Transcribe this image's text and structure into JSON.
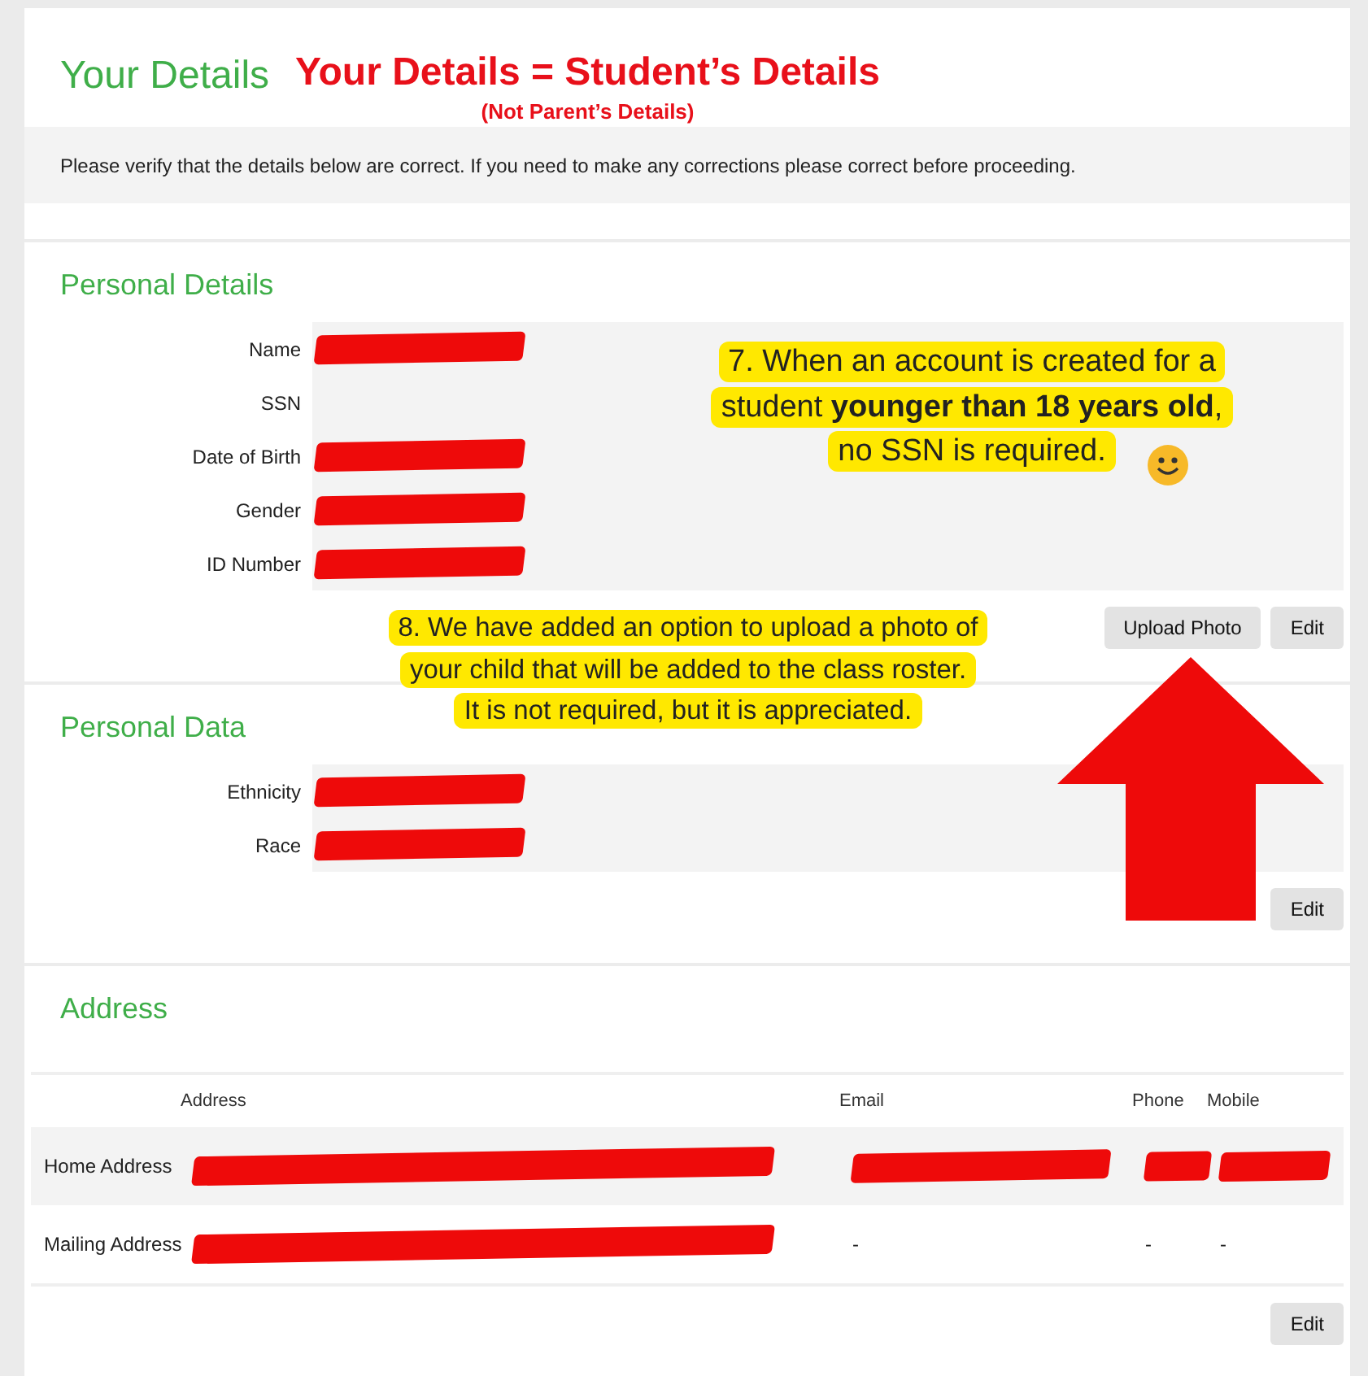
{
  "header": {
    "title": "Your Details"
  },
  "heading_note": {
    "title": "Your Details = Student’s Details",
    "subtitle": "(Not Parent’s Details)"
  },
  "notice": "Please verify that the details below are correct. If you need to make any corrections please correct before proceeding.",
  "sections": [
    {
      "kind": "fields",
      "title": "Personal Details",
      "fields": [
        {
          "label": "Name",
          "redacted": true
        },
        {
          "label": "SSN",
          "redacted": false
        },
        {
          "label": "Date of Birth",
          "redacted": true
        },
        {
          "label": "Gender",
          "redacted": true
        },
        {
          "label": "ID Number",
          "redacted": true
        }
      ],
      "buttons": [
        "Upload Photo",
        "Edit"
      ]
    },
    {
      "kind": "fields",
      "title": "Personal Data",
      "fields": [
        {
          "label": "Ethnicity",
          "redacted": true
        },
        {
          "label": "Race",
          "redacted": true
        }
      ],
      "buttons": [
        "Edit"
      ]
    },
    {
      "kind": "table",
      "title": "Address",
      "columns": [
        "Address",
        "Email",
        "Phone",
        "Mobile"
      ],
      "rows": [
        {
          "label": "Home Address",
          "cells": [
            {
              "redacted": true
            },
            {
              "redacted": true
            },
            {
              "redacted": true
            },
            {
              "redacted": true
            }
          ]
        },
        {
          "label": "Mailing Address",
          "cells": [
            {
              "redacted": true
            },
            {
              "value": "-"
            },
            {
              "value": "-"
            },
            {
              "value": "-"
            }
          ]
        }
      ],
      "buttons": [
        "Edit"
      ]
    }
  ],
  "callouts": [
    {
      "lines": [
        "7. When an account is created for a",
        "student **younger than 18 years old**,",
        "no SSN is required."
      ]
    },
    {
      "lines": [
        "8. We have added an option to upload a photo of",
        "your child that will be added to the class roster.",
        "It is not required, but it is appreciated."
      ]
    }
  ]
}
